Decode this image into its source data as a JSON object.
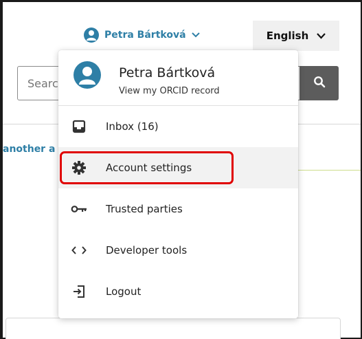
{
  "header": {
    "user_name": "Petra Bártková",
    "language": "English"
  },
  "search": {
    "placeholder": "Search"
  },
  "page": {
    "another_text": "another a"
  },
  "dropdown": {
    "name": "Petra Bártková",
    "subtitle": "View my ORCID record",
    "items": [
      {
        "label": "Inbox (16)",
        "icon": "inbox-icon"
      },
      {
        "label": "Account settings",
        "icon": "gear-icon"
      },
      {
        "label": "Trusted parties",
        "icon": "key-icon"
      },
      {
        "label": "Developer tools",
        "icon": "code-icon"
      },
      {
        "label": "Logout",
        "icon": "logout-icon"
      }
    ]
  },
  "colors": {
    "accent": "#2e7fa6",
    "highlight": "#e00000"
  }
}
